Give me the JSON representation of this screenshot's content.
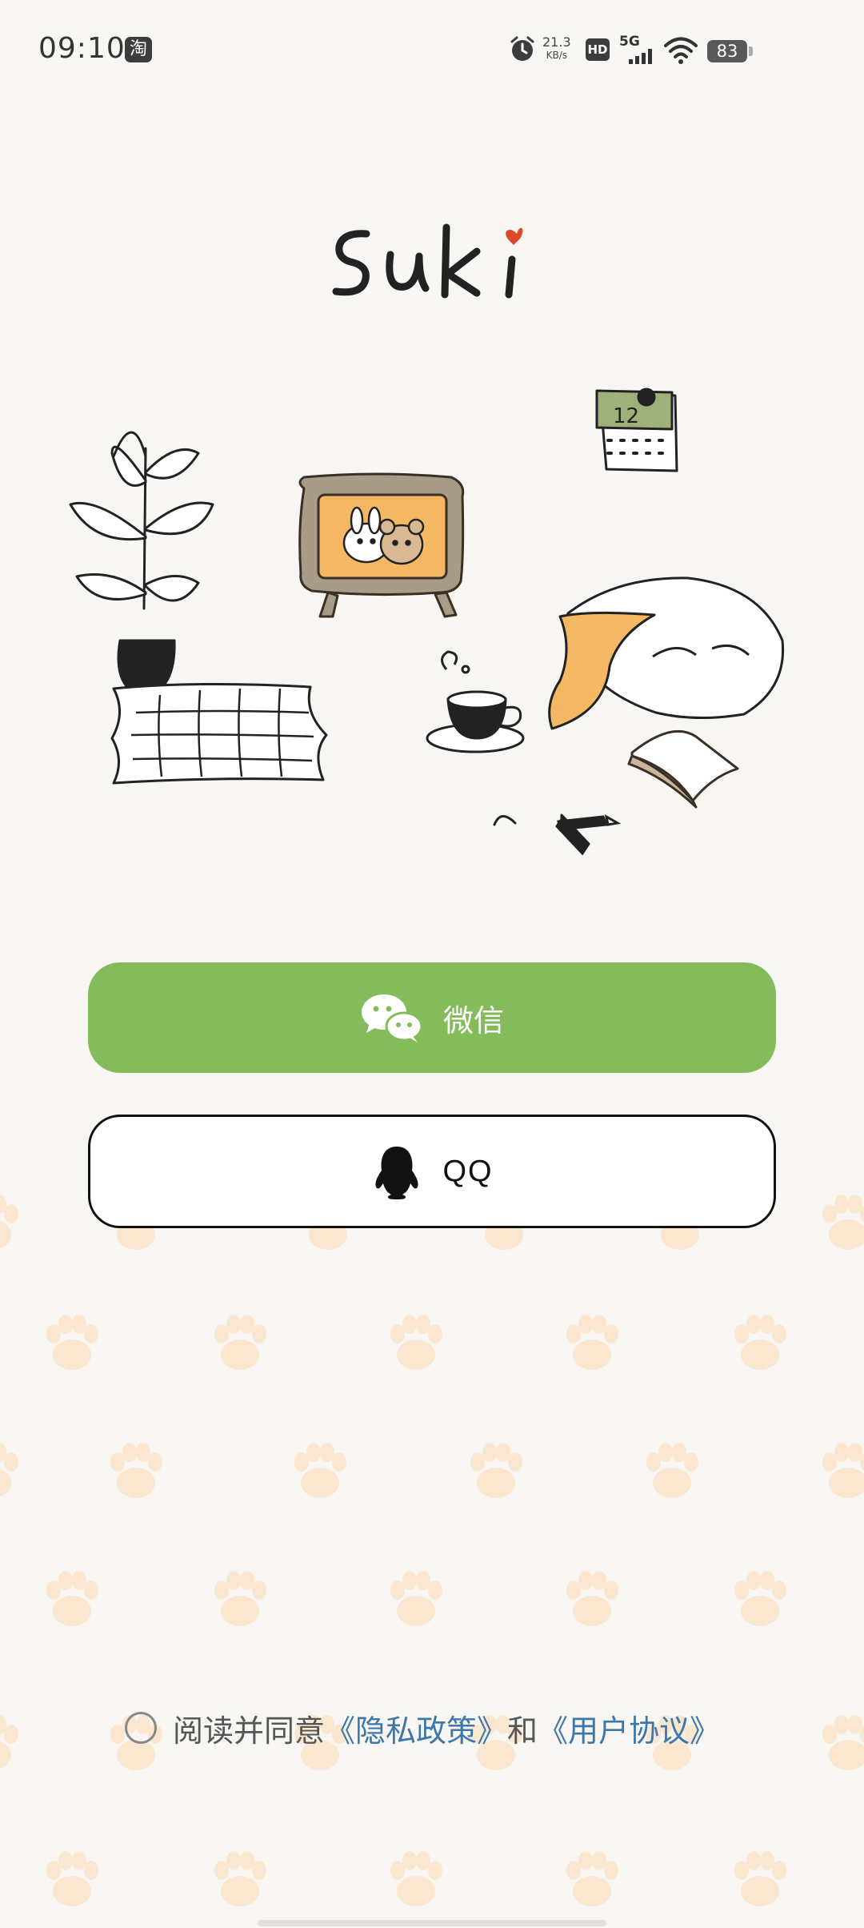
{
  "status_bar": {
    "time": "09:10",
    "app_icon_label": "淘",
    "net_speed_value": "21.3",
    "net_speed_unit": "KB/s",
    "hd_label": "HD",
    "signal_label": "5G",
    "battery_level": "83",
    "icons": [
      "alarm-icon",
      "hd-icon",
      "signal-icon",
      "wifi-icon",
      "battery-icon"
    ]
  },
  "logo": {
    "text": "suki",
    "accent_color": "#e0482c"
  },
  "buttons": {
    "wechat_label": "微信",
    "wechat_color": "#84bc5c",
    "qq_label": "QQ"
  },
  "agreement": {
    "prefix": "阅读并同意",
    "privacy_link": "《隐私政策》",
    "conjunction": "和",
    "terms_link": "《用户协议》",
    "checked": false,
    "link_color": "#3f78a8"
  }
}
